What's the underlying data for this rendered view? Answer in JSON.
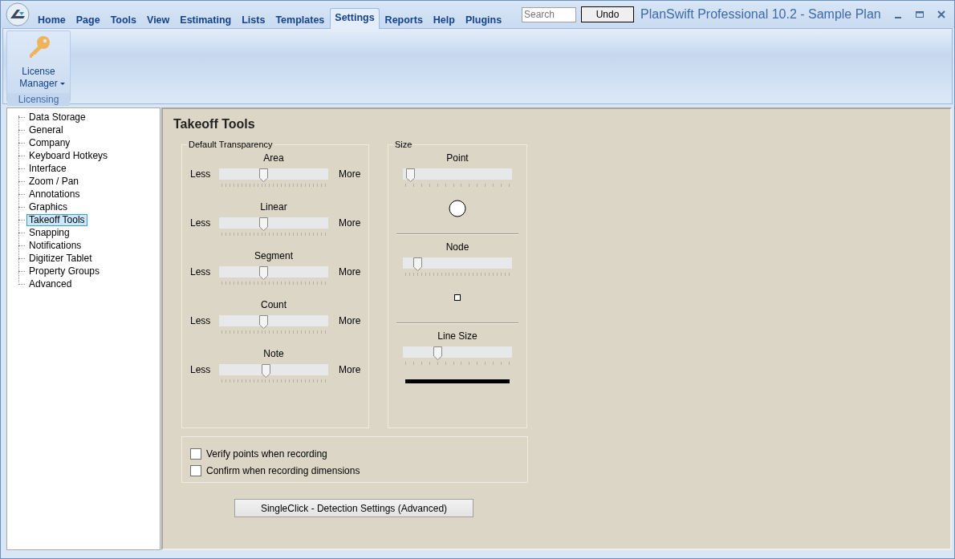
{
  "window": {
    "title": "PlanSwift Professional 10.2 - Sample Plan"
  },
  "tabs": [
    {
      "label": "Home",
      "selected": false
    },
    {
      "label": "Page",
      "selected": false
    },
    {
      "label": "Tools",
      "selected": false
    },
    {
      "label": "View",
      "selected": false
    },
    {
      "label": "Estimating",
      "selected": false
    },
    {
      "label": "Lists",
      "selected": false
    },
    {
      "label": "Templates",
      "selected": false
    },
    {
      "label": "Settings",
      "selected": true
    },
    {
      "label": "Reports",
      "selected": false
    },
    {
      "label": "Help",
      "selected": false
    },
    {
      "label": "Plugins",
      "selected": false
    }
  ],
  "search": {
    "placeholder": "Search"
  },
  "undo_button": "Undo",
  "ribbon": {
    "groups": [
      {
        "label": "Licensing",
        "buttons": [
          {
            "label": "License Manager",
            "dropdown": true
          }
        ]
      }
    ]
  },
  "sidebar": {
    "items": [
      {
        "label": "Data Storage",
        "selected": false
      },
      {
        "label": "General",
        "selected": false
      },
      {
        "label": "Company",
        "selected": false
      },
      {
        "label": "Keyboard Hotkeys",
        "selected": false
      },
      {
        "label": "Interface",
        "selected": false
      },
      {
        "label": "Zoom / Pan",
        "selected": false
      },
      {
        "label": "Annotations",
        "selected": false
      },
      {
        "label": "Graphics",
        "selected": false
      },
      {
        "label": "Takeoff Tools",
        "selected": true
      },
      {
        "label": "Snapping",
        "selected": false
      },
      {
        "label": "Notifications",
        "selected": false
      },
      {
        "label": "Digitizer Tablet",
        "selected": false
      },
      {
        "label": "Property Groups",
        "selected": false
      },
      {
        "label": "Advanced",
        "selected": false
      }
    ]
  },
  "panel": {
    "title": "Takeoff Tools",
    "transparency": {
      "title": "Default Transparency",
      "sliders": [
        {
          "label": "Area",
          "min_label": "Less",
          "max_label": "More",
          "level": 0.4
        },
        {
          "label": "Linear",
          "min_label": "Less",
          "max_label": "More",
          "level": 0.4
        },
        {
          "label": "Segment",
          "min_label": "Less",
          "max_label": "More",
          "level": 0.4
        },
        {
          "label": "Count",
          "min_label": "Less",
          "max_label": "More",
          "level": 0.4
        },
        {
          "label": "Note",
          "min_label": "Less",
          "max_label": "More",
          "level": 0.42
        }
      ]
    },
    "size": {
      "title": "Size",
      "sliders": [
        {
          "label": "Point",
          "level": 0.03,
          "kind": "circle"
        },
        {
          "label": "Node",
          "level": 0.1,
          "kind": "square"
        },
        {
          "label": "Line Size",
          "level": 0.3,
          "kind": "line"
        }
      ]
    },
    "checkboxes": [
      {
        "label": "Verify points when recording",
        "checked": false
      },
      {
        "label": "Confirm when recording dimensions",
        "checked": false
      }
    ],
    "button": "SingleClick - Detection Settings (Advanced)"
  }
}
